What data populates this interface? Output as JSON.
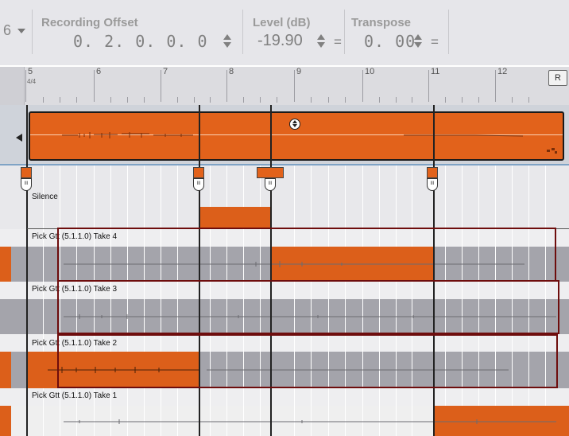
{
  "top_bar": {
    "lead_char": "6",
    "recording_offset": {
      "label": "Recording Offset",
      "value": "0. 2. 0.   0. 0"
    },
    "level": {
      "label": "Level (dB)",
      "value": "-19.90",
      "suffix": "="
    },
    "transpose": {
      "label": "Transpose",
      "value": "0. 00",
      "suffix": "="
    }
  },
  "ruler": {
    "time_signature": "4/4",
    "bars": [
      "5",
      "6",
      "7",
      "8",
      "9",
      "10",
      "11",
      "12"
    ],
    "button_label": "R"
  },
  "comping": {
    "silence_label": "Silence",
    "lanes": [
      {
        "title": "Pick Gtt (5.1.1.0) Take 4"
      },
      {
        "title": "Pick Gtt (5.1.1.0) Take 3"
      },
      {
        "title": "Pick Gtt (5.1.1.0) Take 2"
      },
      {
        "title": "Pick Gtt (5.1.1.0) Take 1"
      }
    ]
  },
  "colors": {
    "region_orange": "#e2621b",
    "selection_border": "#6e0d0d",
    "ruler_bg": "#dcdce0"
  }
}
